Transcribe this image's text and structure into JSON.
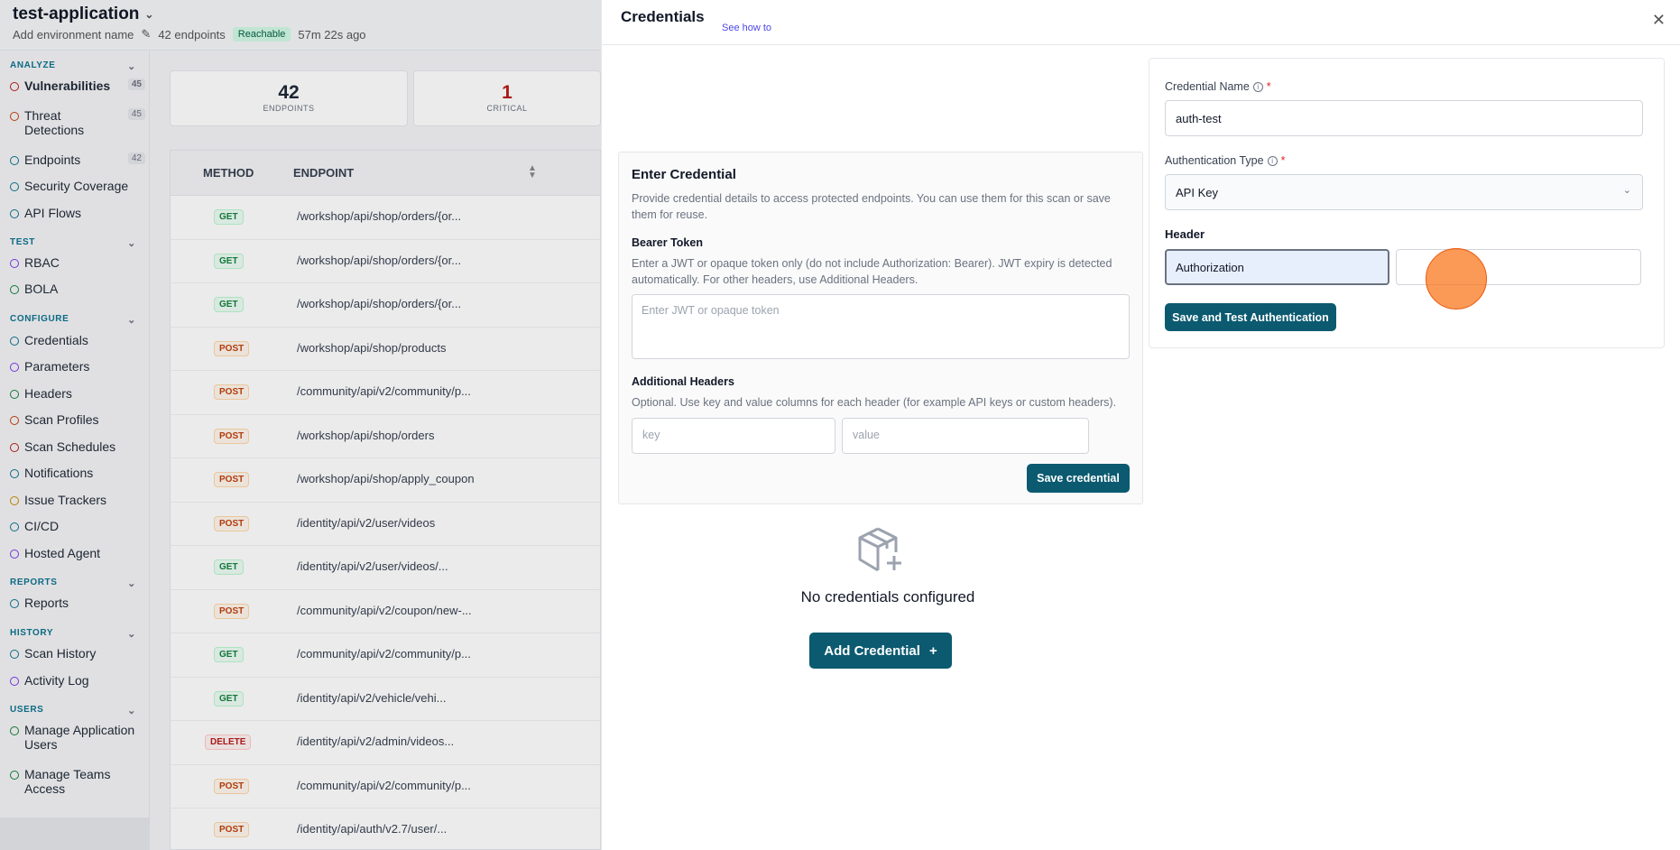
{
  "header": {
    "app_title": "test-application",
    "env_name": "Add environment name",
    "endpoints": "42 endpoints",
    "status": "Reachable",
    "last_seen": "57m 22s ago"
  },
  "sidebar": {
    "analyze": "ANALYZE",
    "test": "TEST",
    "configure": "CONFIGURE",
    "reports": "REPORTS",
    "history": "HISTORY",
    "users": "USERS",
    "items": {
      "vulnerabilities": {
        "label": "Vulnerabilities",
        "count": "45"
      },
      "threats": {
        "label": "Threat Detections",
        "count": "45"
      },
      "endpoints": {
        "label": "Endpoints",
        "count": "42"
      },
      "security": {
        "label": "Security Coverage"
      },
      "flows": {
        "label": "API Flows"
      },
      "rbac": {
        "label": "RBAC"
      },
      "bola": {
        "label": "BOLA"
      },
      "credentials": {
        "label": "Credentials"
      },
      "parameters": {
        "label": "Parameters"
      },
      "headers": {
        "label": "Headers"
      },
      "profiles": {
        "label": "Scan Profiles"
      },
      "schedules": {
        "label": "Scan Schedules"
      },
      "notifications": {
        "label": "Notifications"
      },
      "trackers": {
        "label": "Issue Trackers"
      },
      "cicd": {
        "label": "CI/CD"
      },
      "agent": {
        "label": "Hosted Agent"
      },
      "reports": {
        "label": "Reports"
      },
      "scanhistory": {
        "label": "Scan History"
      },
      "activity": {
        "label": "Activity Log"
      },
      "appusers": {
        "label": "Manage Application Users"
      },
      "teams": {
        "label": "Manage Teams Access"
      }
    }
  },
  "stats": {
    "endpoints": {
      "value": "42",
      "label": "ENDPOINTS"
    },
    "critical": {
      "value": "1",
      "label": "CRITICAL"
    }
  },
  "table": {
    "col_method": "METHOD",
    "col_endpoint": "ENDPOINT",
    "rows": [
      {
        "method": "GET",
        "path": "/workshop/api/shop/orders/{or..."
      },
      {
        "method": "GET",
        "path": "/workshop/api/shop/orders/{or..."
      },
      {
        "method": "GET",
        "path": "/workshop/api/shop/orders/{or..."
      },
      {
        "method": "POST",
        "path": "/workshop/api/shop/products"
      },
      {
        "method": "POST",
        "path": "/community/api/v2/community/p..."
      },
      {
        "method": "POST",
        "path": "/workshop/api/shop/orders"
      },
      {
        "method": "POST",
        "path": "/workshop/api/shop/apply_coupon"
      },
      {
        "method": "POST",
        "path": "/identity/api/v2/user/videos"
      },
      {
        "method": "GET",
        "path": "/identity/api/v2/user/videos/..."
      },
      {
        "method": "POST",
        "path": "/community/api/v2/coupon/new-..."
      },
      {
        "method": "GET",
        "path": "/community/api/v2/community/p..."
      },
      {
        "method": "GET",
        "path": "/identity/api/v2/vehicle/vehi..."
      },
      {
        "method": "DELETE",
        "path": "/identity/api/v2/admin/videos..."
      },
      {
        "method": "POST",
        "path": "/community/api/v2/community/p..."
      },
      {
        "method": "POST",
        "path": "/identity/api/auth/v2.7/user/..."
      }
    ]
  },
  "panel": {
    "title": "Credentials",
    "see_how": "See how to",
    "enter_credential": {
      "title": "Enter Credential",
      "description": "Provide credential details to access protected endpoints. You can use them for this scan or save them for reuse.",
      "bearer_label": "Bearer Token",
      "bearer_help": "Enter a JWT or opaque token only (do not include Authorization: Bearer). JWT expiry is detected automatically. For other headers, use Additional Headers.",
      "bearer_placeholder": "Enter JWT or opaque token",
      "addl_label": "Additional Headers",
      "addl_help": "Optional. Use key and value columns for each header (for example API keys or custom headers).",
      "key_placeholder": "key",
      "value_placeholder": "value",
      "save_button": "Save credential"
    },
    "empty": {
      "text": "No credentials configured",
      "add_button": "Add Credential"
    },
    "form": {
      "name_label": "Credential Name",
      "name_value": "auth-test",
      "type_label": "Authentication Type",
      "type_value": "API Key",
      "header_label": "Header",
      "header_key_value": "Authorization",
      "save_test_button": "Save and Test Authentication"
    }
  },
  "colors": {
    "primary": "#0b5a70",
    "accent": "#0e7490"
  }
}
